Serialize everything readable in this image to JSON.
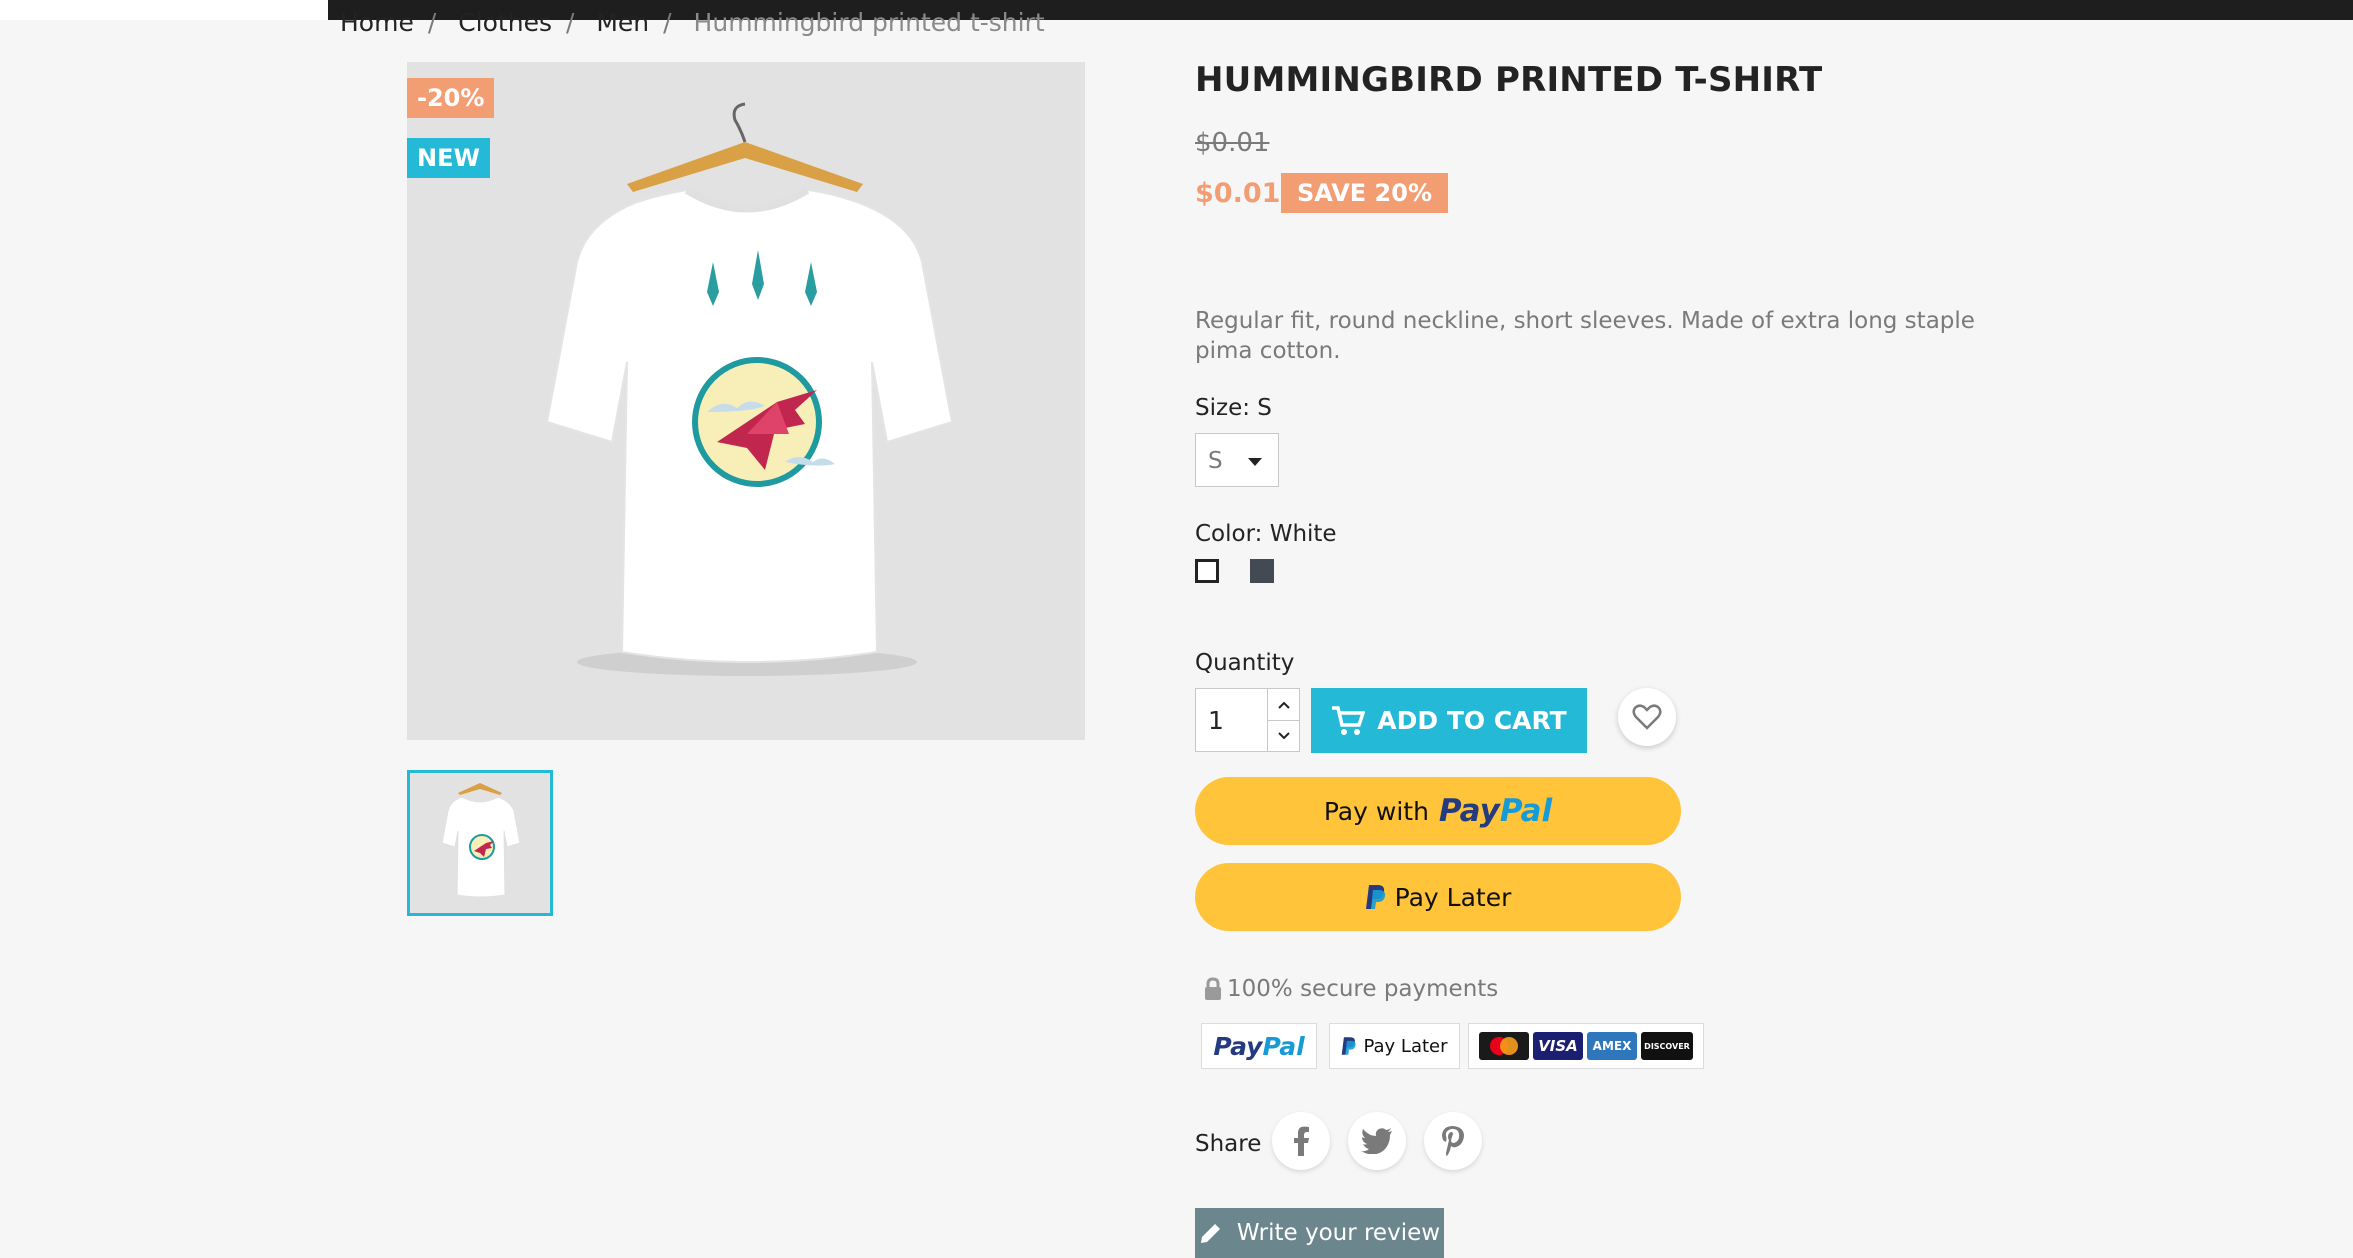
{
  "breadcrumb": [
    "Home",
    "Clothes",
    "Men",
    "Hummingbird printed t-shirt"
  ],
  "product": {
    "flags": {
      "discount": "-20%",
      "new": "NEW"
    },
    "title": "HUMMINGBIRD PRINTED T-SHIRT",
    "regular_price": "$0.01",
    "price": "$0.01",
    "save_badge": "SAVE 20%",
    "description": "Regular fit, round neckline, short sleeves. Made of extra long staple pima cotton.",
    "size": {
      "label": "Size: S",
      "selected": "S"
    },
    "color": {
      "label": "Color: White",
      "swatches": [
        "#ffffff",
        "#434a54"
      ]
    },
    "quantity": {
      "label": "Quantity",
      "value": "1"
    },
    "add_to_cart": "ADD TO CART"
  },
  "paypal": {
    "pay_with": "Pay with",
    "logo_a": "Pay",
    "logo_b": "Pal",
    "pay_later": "Pay Later"
  },
  "secure": {
    "text": "100% secure payments",
    "paypal_logo_a": "Pay",
    "paypal_logo_b": "Pal",
    "paylater_text": "Pay Later",
    "cards": [
      "mastercard",
      "VISA",
      "AMEX",
      "DISCOVER"
    ]
  },
  "share": {
    "label": "Share"
  },
  "review": {
    "label": "Write your review"
  },
  "colors": {
    "accent": "#24b9d7",
    "discount": "#f39d72",
    "paypal_yellow": "#ffc439",
    "review_btn": "#6c868e"
  }
}
